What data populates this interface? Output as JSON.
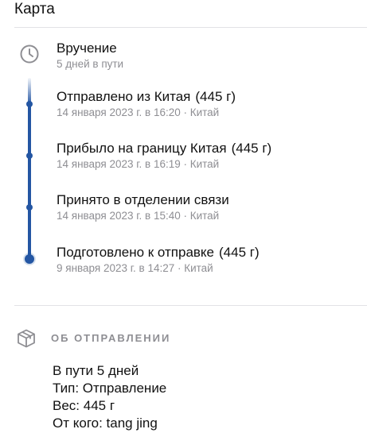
{
  "header": {
    "map_link": "Карта"
  },
  "status": {
    "title": "Вручение",
    "subtitle": "5 дней в пути"
  },
  "events": [
    {
      "title": "Отправлено из Китая",
      "weight": "(445 г)",
      "meta": "14 января 2023 г. в 16:20 · Китай"
    },
    {
      "title": "Прибыло на границу Китая",
      "weight": "(445 г)",
      "meta": "14 января 2023 г. в 16:19 · Китай"
    },
    {
      "title": "Принято в отделении связи",
      "weight": "",
      "meta": "14 января 2023 г. в 15:40 · Китай"
    },
    {
      "title": "Подготовлено к отправке",
      "weight": "(445 г)",
      "meta": "9 января 2023 г. в 14:27 · Китай"
    }
  ],
  "shipment": {
    "heading": "ОБ ОТПРАВЛЕНИИ",
    "in_transit": "В пути 5 дней",
    "type": "Тип: Отправление",
    "weight": "Вес: 445 г",
    "sender": "От кого: tang jing"
  },
  "colors": {
    "accent": "#2456a3",
    "secondary_text": "#8e8e93",
    "divider": "#e2e2e6"
  },
  "icons": {
    "status": "clock-icon",
    "shipment": "box-icon"
  }
}
